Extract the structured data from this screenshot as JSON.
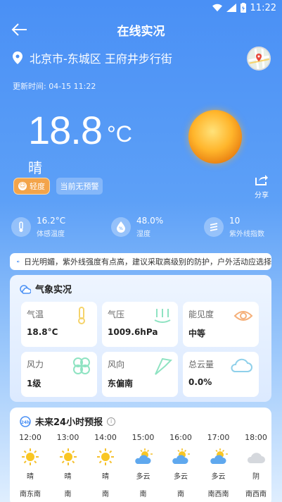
{
  "status_bar": {
    "time": "11:22"
  },
  "header": {
    "title": "在线实况"
  },
  "location": {
    "name": "北京市-东城区 王府井步行街"
  },
  "update_time": "更新时间: 04-15 11:22",
  "current": {
    "temp": "18.8",
    "unit": "°C",
    "condition": "晴",
    "aqi_label": "轻度",
    "alert": "当前无预警",
    "share_label": "分享"
  },
  "metrics": [
    {
      "value": "16.2°C",
      "label": "体感温度",
      "icon": "thermometer-icon"
    },
    {
      "value": "48.0%",
      "label": "湿度",
      "icon": "humidity-icon"
    },
    {
      "value": "10",
      "label": "紫外线指数",
      "icon": "uv-icon"
    }
  ],
  "notice": "日光明媚，紫外线强度有点高，建议采取高级别的防护，户外活动应选择",
  "observation": {
    "title": "气象实况",
    "cells": [
      {
        "label": "气温",
        "value": "18.8°C",
        "icon": "thermometer-icon"
      },
      {
        "label": "气压",
        "value": "1009.6hPa",
        "icon": "pressure-icon"
      },
      {
        "label": "能见度",
        "value": "中等",
        "icon": "eye-icon"
      },
      {
        "label": "风力",
        "value": "1级",
        "icon": "wind-icon"
      },
      {
        "label": "风向",
        "value": "东偏南",
        "icon": "flag-icon"
      },
      {
        "label": "总云量",
        "value": "0.0%",
        "icon": "cloud-icon"
      }
    ]
  },
  "forecast": {
    "title": "未来24小时预报",
    "hours": [
      {
        "time": "12:00",
        "cond": "晴",
        "wind": "南东南",
        "icon": "sun-icon"
      },
      {
        "time": "13:00",
        "cond": "晴",
        "wind": "南",
        "icon": "sun-icon"
      },
      {
        "time": "14:00",
        "cond": "晴",
        "wind": "南",
        "icon": "sun-icon"
      },
      {
        "time": "15:00",
        "cond": "多云",
        "wind": "南",
        "icon": "partly-cloudy-icon"
      },
      {
        "time": "16:00",
        "cond": "多云",
        "wind": "南",
        "icon": "partly-cloudy-icon"
      },
      {
        "time": "17:00",
        "cond": "多云",
        "wind": "南西南",
        "icon": "partly-cloudy-icon"
      },
      {
        "time": "18:00",
        "cond": "阴",
        "wind": "南西南",
        "icon": "overcast-icon"
      }
    ]
  },
  "colors": {
    "accent": "#4a90f5",
    "aqi": "#f3a44a",
    "icon_green": "#8fe3c2",
    "icon_yellow": "#f5d36a",
    "icon_cloud": "#8fd0ea"
  }
}
